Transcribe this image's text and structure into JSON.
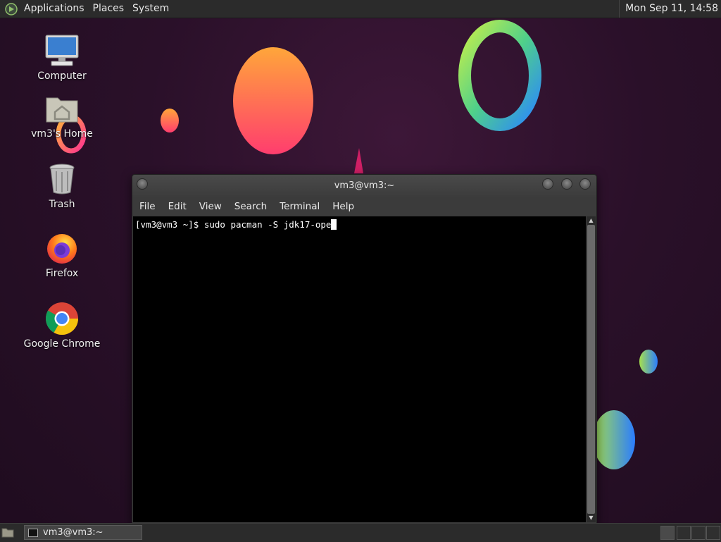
{
  "top_panel": {
    "menus": [
      "Applications",
      "Places",
      "System"
    ],
    "clock": "Mon Sep 11, 14:58"
  },
  "desktop": {
    "icons": [
      {
        "label": "Computer",
        "icon": "computer-icon"
      },
      {
        "label": "vm3's Home",
        "icon": "home-folder-icon"
      },
      {
        "label": "Trash",
        "icon": "trash-icon"
      },
      {
        "label": "Firefox",
        "icon": "firefox-icon"
      },
      {
        "label": "Google Chrome",
        "icon": "chrome-icon"
      }
    ]
  },
  "terminal": {
    "title": "vm3@vm3:~",
    "menu": [
      "File",
      "Edit",
      "View",
      "Search",
      "Terminal",
      "Help"
    ],
    "lines": [
      "[vm3@vm3 ~]$ sudo pacman -S jdk17-ope"
    ]
  },
  "taskbar": {
    "tasks": [
      {
        "label": "vm3@vm3:~",
        "icon": "terminal-icon"
      }
    ]
  },
  "colors": {
    "desktop_bg": "#2a1029",
    "panel_bg": "#2b2b2b",
    "terminal_bg": "#000000"
  }
}
